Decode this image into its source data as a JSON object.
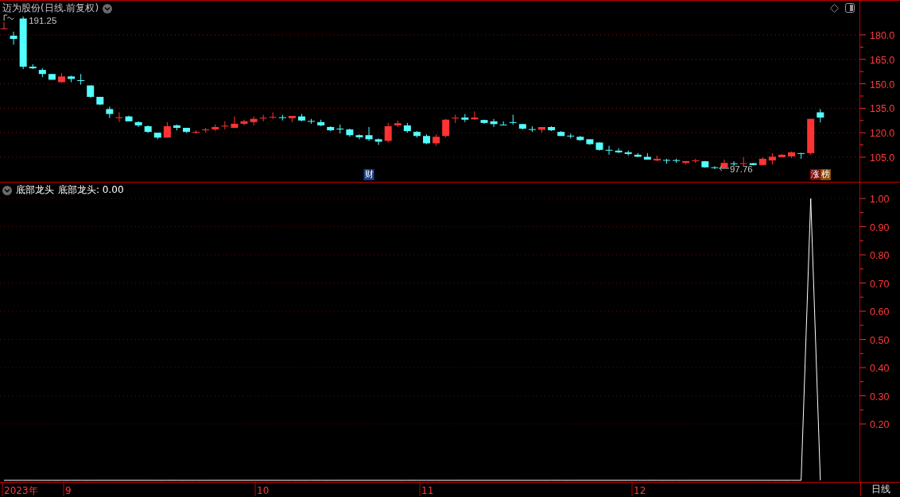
{
  "header": {
    "title": "迈为股份(日线.前复权)"
  },
  "price_chart": {
    "chart_data": {
      "type": "candlestick",
      "grid": true,
      "ylim": [
        89.9,
        200.9
      ],
      "yticks": [
        {
          "value": 180,
          "label": "180.0"
        },
        {
          "value": 165,
          "label": "165.0"
        },
        {
          "value": 150,
          "label": "150.0"
        },
        {
          "value": 135,
          "label": "135.0"
        },
        {
          "value": 120,
          "label": "120.0"
        },
        {
          "value": 105,
          "label": "105.0"
        }
      ],
      "ohlc": [
        [
          183.8,
          188,
          183.5,
          184
        ],
        [
          179.5,
          182,
          174,
          177.5
        ],
        [
          190,
          191.25,
          159,
          160.5
        ],
        [
          160.5,
          162,
          159,
          159.5
        ],
        [
          158.5,
          159.5,
          154,
          156
        ],
        [
          156,
          156,
          152.5,
          152.5
        ],
        [
          151,
          156.5,
          150.5,
          154.5
        ],
        [
          154.5,
          155,
          151,
          153
        ],
        [
          152.2,
          156,
          149.5,
          151.8
        ],
        [
          149,
          149,
          141.5,
          142
        ],
        [
          142,
          142,
          137,
          137.3
        ],
        [
          134.5,
          136,
          129,
          131.5
        ],
        [
          129,
          132.5,
          126.5,
          129.5
        ],
        [
          130,
          130.5,
          127,
          127
        ],
        [
          126.5,
          127,
          123.5,
          124.5
        ],
        [
          124,
          124.5,
          120,
          120.5
        ],
        [
          120,
          120,
          116,
          117
        ],
        [
          117,
          126.5,
          117,
          124
        ],
        [
          124.5,
          125,
          121.5,
          123
        ],
        [
          123,
          123,
          120,
          120.5
        ],
        [
          120,
          121.5,
          119.5,
          120.5
        ],
        [
          121.5,
          123,
          120,
          122
        ],
        [
          122,
          125,
          121,
          123.5
        ],
        [
          124,
          127,
          122,
          124.3
        ],
        [
          123,
          130,
          123,
          125.5
        ],
        [
          125.5,
          128,
          124.5,
          127
        ],
        [
          126.5,
          130,
          124.5,
          128.5
        ],
        [
          129,
          131,
          127,
          129.2
        ],
        [
          129.5,
          132.5,
          128.5,
          129.7
        ],
        [
          129.5,
          131,
          127.5,
          129.2
        ],
        [
          128.9,
          130.3,
          126.5,
          130.3
        ],
        [
          130,
          131.5,
          127,
          127.5
        ],
        [
          127.2,
          128.5,
          125.5,
          127
        ],
        [
          126.5,
          128,
          124,
          124.5
        ],
        [
          123.5,
          124,
          121,
          121.5
        ],
        [
          122.5,
          125,
          119.5,
          122.2
        ],
        [
          122,
          122.5,
          117.5,
          118.5
        ],
        [
          118.5,
          119,
          116,
          117.2
        ],
        [
          118.5,
          123.5,
          115,
          116
        ],
        [
          116,
          116.5,
          112.5,
          114.5
        ],
        [
          115,
          126,
          114,
          124
        ],
        [
          124.5,
          127.5,
          123.5,
          125.8
        ],
        [
          124.5,
          126,
          120,
          121
        ],
        [
          120.5,
          121,
          117,
          118
        ],
        [
          118,
          119,
          113,
          113.5
        ],
        [
          113.5,
          119,
          112,
          117.5
        ],
        [
          118,
          128.5,
          117,
          128
        ],
        [
          128.8,
          131,
          126,
          129.2
        ],
        [
          129.3,
          131.5,
          126.5,
          128
        ],
        [
          128.2,
          133,
          128,
          129.3
        ],
        [
          127.8,
          128,
          125.5,
          126
        ],
        [
          127,
          128.5,
          123.5,
          125.3
        ],
        [
          125,
          127,
          124.5,
          124.8
        ],
        [
          126.5,
          131,
          125,
          126.2
        ],
        [
          125.3,
          125.5,
          122,
          122.5
        ],
        [
          122.2,
          124,
          120.5,
          122
        ],
        [
          121.8,
          123.5,
          120,
          123.5
        ],
        [
          123.5,
          124,
          121,
          121.5
        ],
        [
          120.5,
          121,
          118,
          118
        ],
        [
          118.2,
          119.5,
          116.5,
          118
        ],
        [
          117.5,
          118,
          115,
          115.5
        ],
        [
          116,
          116,
          112.5,
          113
        ],
        [
          114,
          114,
          109,
          109.5
        ],
        [
          109.5,
          112,
          106.5,
          109.3
        ],
        [
          109,
          110.5,
          107.5,
          108
        ],
        [
          108,
          109,
          106,
          107
        ],
        [
          106.5,
          107.5,
          105,
          105.3
        ],
        [
          105.2,
          107.5,
          103.5,
          103.5
        ],
        [
          103,
          106,
          102.5,
          104
        ],
        [
          103.3,
          104,
          101,
          103
        ],
        [
          103.2,
          104,
          101.5,
          103
        ],
        [
          101.5,
          102.6,
          100.5,
          102.6
        ],
        [
          102.8,
          104,
          101.5,
          103
        ],
        [
          102.5,
          102.7,
          98.5,
          98.8
        ],
        [
          98.8,
          99.5,
          97.76,
          98.6
        ],
        [
          98.6,
          103.5,
          98.4,
          101.5
        ],
        [
          101.2,
          102.5,
          99.5,
          101
        ],
        [
          101,
          105,
          99.5,
          101.3
        ],
        [
          101.3,
          101.5,
          100,
          100.2
        ],
        [
          100.2,
          105,
          100.2,
          104
        ],
        [
          103,
          107.5,
          100.5,
          105.3
        ],
        [
          105,
          107,
          105,
          106.5
        ],
        [
          105.5,
          108.5,
          104.5,
          108
        ],
        [
          107.5,
          107.6,
          104,
          107.4
        ],
        [
          107.5,
          128.5,
          106.5,
          128.5
        ],
        [
          132.5,
          134.5,
          126.3,
          129.3
        ]
      ]
    },
    "high_label": "191.25",
    "low_label": "97.76",
    "badges": [
      {
        "labels": [
          {
            "text": "财",
            "color": "#1d3f86"
          }
        ]
      },
      {
        "labels": [
          {
            "text": "涨",
            "color": "#7a0a0a"
          },
          {
            "text": "榜",
            "color": "#8a4a0a"
          }
        ]
      }
    ]
  },
  "indicator": {
    "reading": "底部龙头: 0.00",
    "chart_data": {
      "type": "line",
      "grid": true,
      "ylim": [
        0,
        1
      ],
      "yticks": [
        {
          "value": 1,
          "label": "1.00"
        },
        {
          "value": 0.9,
          "label": "0.90"
        },
        {
          "value": 0.8,
          "label": "0.80"
        },
        {
          "value": 0.7,
          "label": "0.70"
        },
        {
          "value": 0.6,
          "label": "0.60"
        },
        {
          "value": 0.5,
          "label": "0.50"
        },
        {
          "value": 0.4,
          "label": "0.40"
        },
        {
          "value": 0.3,
          "label": "0.30"
        },
        {
          "value": 0.2,
          "label": "0.20"
        }
      ],
      "series": [
        {
          "name": "底部龙头",
          "color": "#ffffff",
          "values": [
            0,
            0,
            0,
            0,
            0,
            0,
            0,
            0,
            0,
            0,
            0,
            0,
            0,
            0,
            0,
            0,
            0,
            0,
            0,
            0,
            0,
            0,
            0,
            0,
            0,
            0,
            0,
            0,
            0,
            0,
            0,
            0,
            0,
            0,
            0,
            0,
            0,
            0,
            0,
            0,
            0,
            0,
            0,
            0,
            0,
            0,
            0,
            0,
            0,
            0,
            0,
            0,
            0,
            0,
            0,
            0,
            0,
            0,
            0,
            0,
            0,
            0,
            0,
            0,
            0,
            0,
            0,
            0,
            0,
            0,
            0,
            0,
            0,
            0,
            0,
            0,
            0,
            0,
            0,
            0,
            0,
            0,
            0,
            0,
            1,
            0
          ]
        }
      ]
    }
  },
  "date_axis": [
    "2023年",
    "9",
    "10",
    "11",
    "12"
  ],
  "period": "日线"
}
